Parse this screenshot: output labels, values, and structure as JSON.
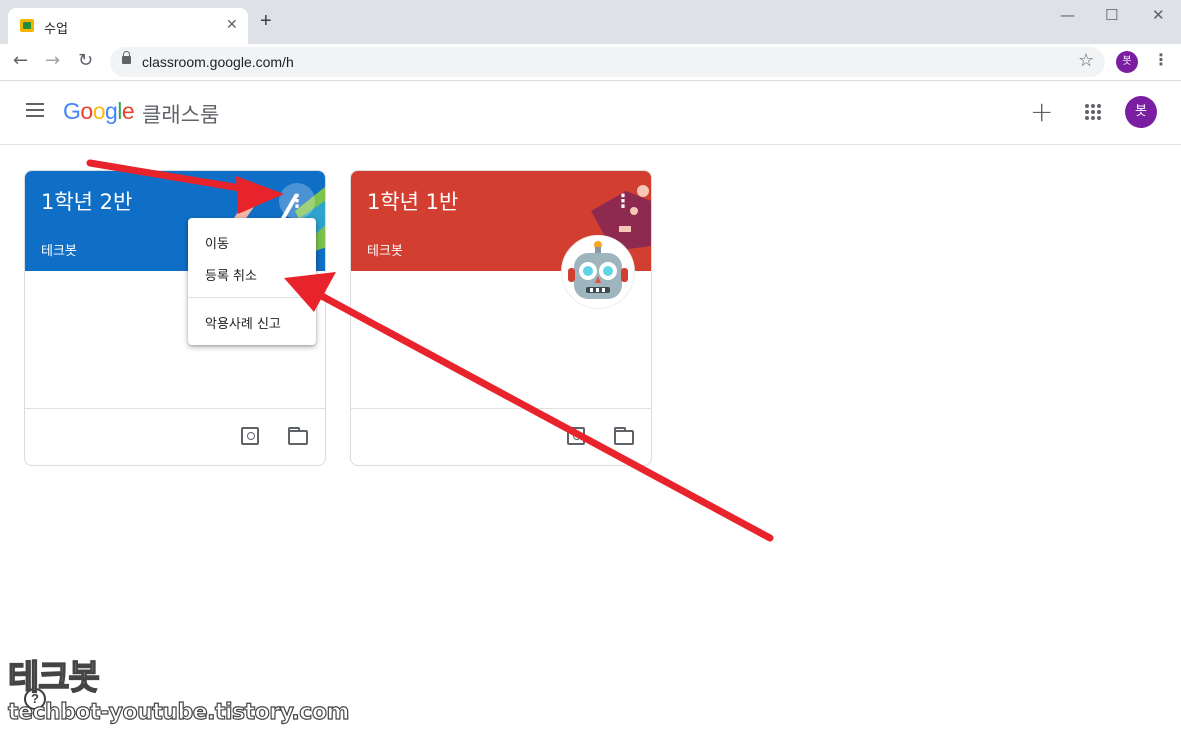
{
  "browser": {
    "tab_title": "수업",
    "tab_close": "✕",
    "new_tab": "+",
    "minimize": "—",
    "maximize": "☐",
    "close": "✕",
    "back": "←",
    "forward": "→",
    "reload": "↻",
    "url": "classroom.google.com/h",
    "bookmark": "☆",
    "profile_initial": "봇",
    "menu": "⋮"
  },
  "header": {
    "logo_letters": [
      "G",
      "o",
      "o",
      "g",
      "l",
      "e"
    ],
    "logo_colors": [
      "#4285F4",
      "#EA4335",
      "#FBBC05",
      "#4285F4",
      "#34A853",
      "#EA4335"
    ],
    "product_name": "클래스룸",
    "create_icon": "+",
    "avatar_initial": "봇"
  },
  "cards": [
    {
      "title": "1학년 2반",
      "teacher": "테크봇",
      "banner_color": "#0f6fc6",
      "more": "⋮"
    },
    {
      "title": "1학년 1반",
      "teacher": "테크봇",
      "banner_color": "#d23f31",
      "more": "⋮"
    }
  ],
  "menu": {
    "items": [
      "이동",
      "등록 취소",
      "악용사례 신고"
    ]
  },
  "watermark": {
    "title": "테크봇",
    "url": "techbot-youtube.tistory.com"
  },
  "help": "?",
  "colors": {
    "arrow": "#e8232b",
    "avatar_purple": "#7b1fa2"
  }
}
